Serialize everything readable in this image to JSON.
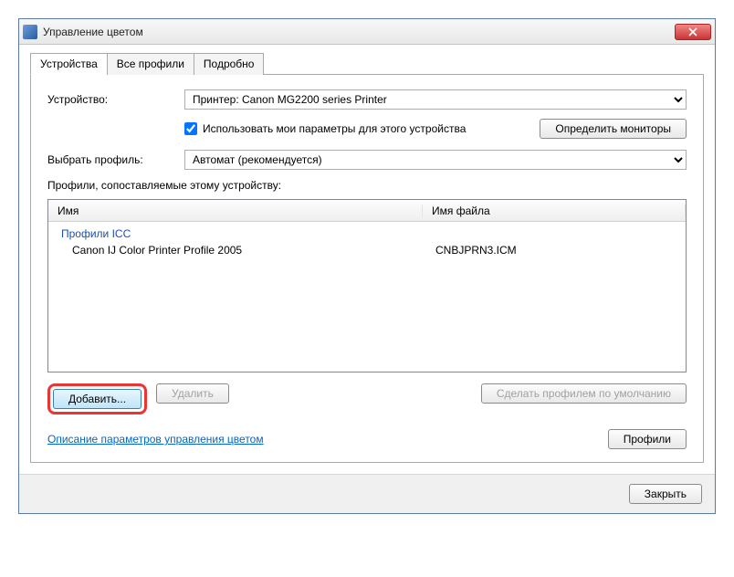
{
  "window": {
    "title": "Управление цветом"
  },
  "tabs": {
    "devices": "Устройства",
    "all_profiles": "Все профили",
    "advanced": "Подробно"
  },
  "device": {
    "label": "Устройство:",
    "selected": "Принтер: Canon MG2200 series Printer"
  },
  "use_my_settings": {
    "label": "Использовать мои параметры для этого устройства",
    "checked": true
  },
  "identify_monitors": "Определить мониторы",
  "profile_select": {
    "label": "Выбрать профиль:",
    "selected": "Автомат (рекомендуется)"
  },
  "list": {
    "caption": "Профили, сопоставляемые этому устройству:",
    "col_name": "Имя",
    "col_file": "Имя файла",
    "group": "Профили ICC",
    "rows": [
      {
        "name": "Canon IJ Color Printer Profile 2005",
        "file": "CNBJPRN3.ICM"
      }
    ]
  },
  "buttons": {
    "add": "Добавить...",
    "remove": "Удалить",
    "set_default": "Сделать профилем по умолчанию",
    "profiles": "Профили",
    "close": "Закрыть"
  },
  "link": "Описание параметров управления цветом"
}
